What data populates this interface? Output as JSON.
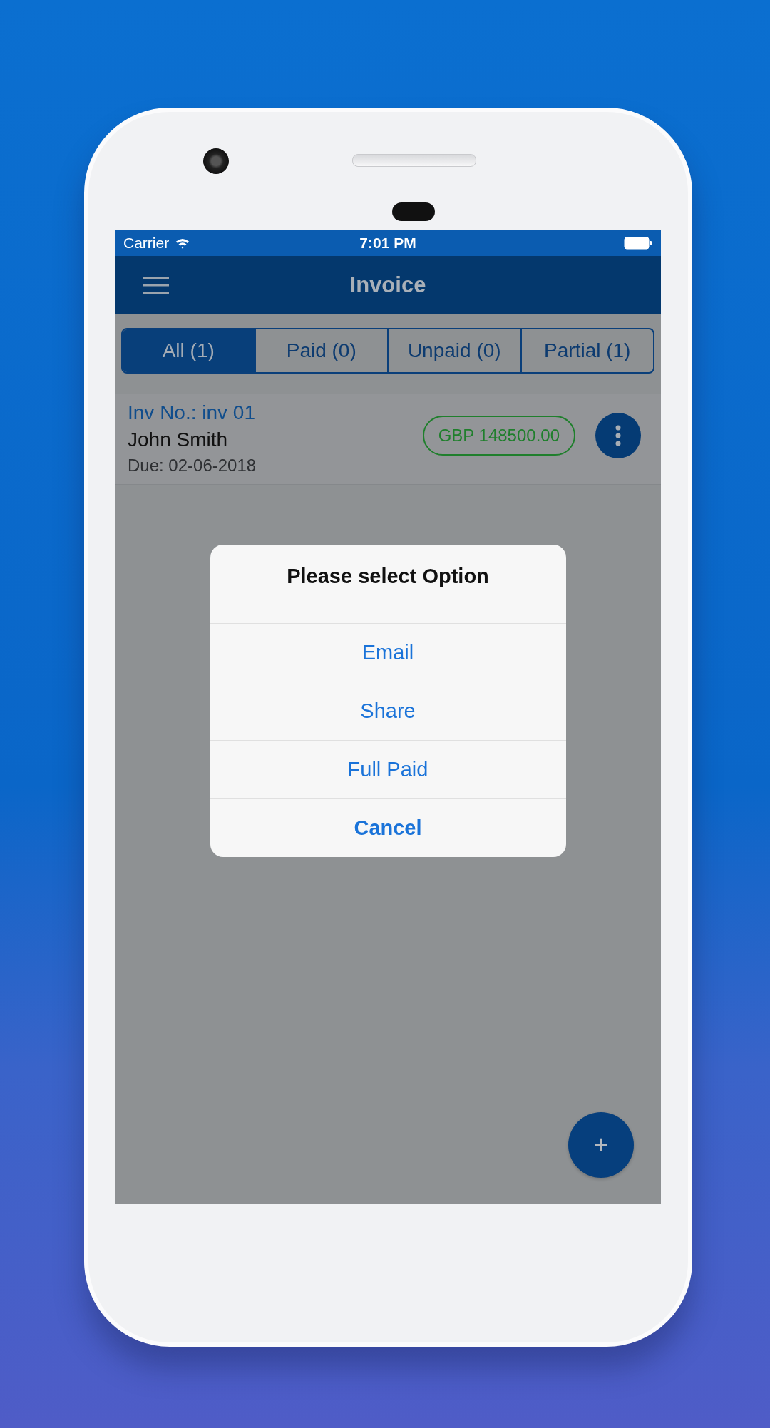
{
  "status_bar": {
    "carrier": "Carrier",
    "time": "7:01 PM"
  },
  "header": {
    "title": "Invoice"
  },
  "tabs": [
    {
      "label": "All (1)",
      "selected": true
    },
    {
      "label": "Paid (0)",
      "selected": false
    },
    {
      "label": "Unpaid (0)",
      "selected": false
    },
    {
      "label": "Partial (1)",
      "selected": false
    }
  ],
  "invoices": [
    {
      "number": "Inv No.: inv 01",
      "customer": "John Smith",
      "due": "Due: 02-06-2018",
      "amount": "GBP 148500.00"
    }
  ],
  "dialog": {
    "title": "Please select Option",
    "options": [
      {
        "label": "Email",
        "kind": "default"
      },
      {
        "label": "Share",
        "kind": "default"
      },
      {
        "label": "Full Paid",
        "kind": "default"
      },
      {
        "label": "Cancel",
        "kind": "cancel"
      }
    ]
  },
  "fab": {
    "label": "+"
  }
}
